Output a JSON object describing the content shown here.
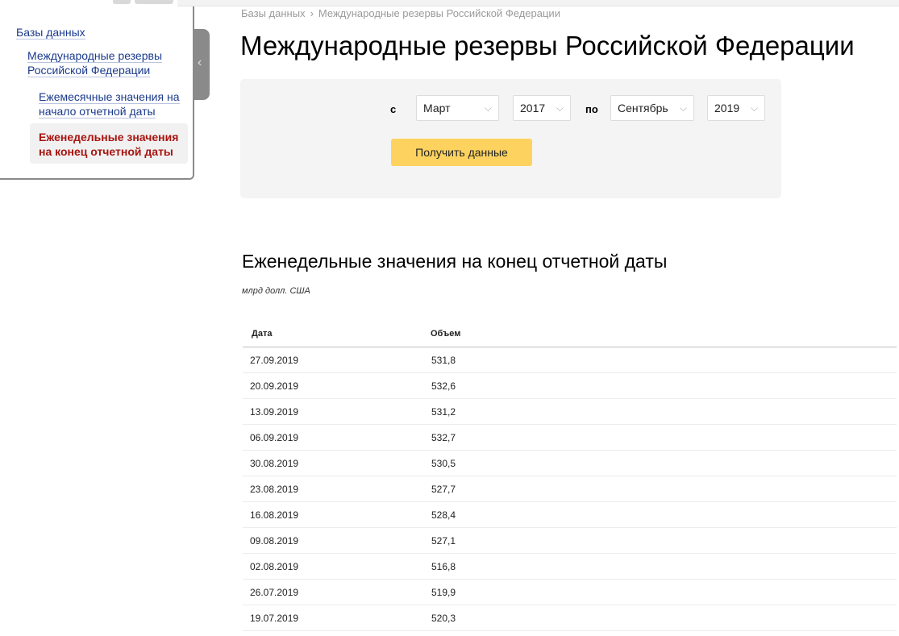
{
  "breadcrumb": [
    "Базы данных",
    "Международные резервы Российской Федерации"
  ],
  "sidebar": {
    "root": "Базы данных",
    "level1": "Международные резервы Российской Федерации",
    "level2": "Ежемесячные значения на начало отчетной даты",
    "active": "Еженедельные значения на конец отчетной даты"
  },
  "page_title": "Международные резервы Российской Федерации",
  "filter": {
    "from_label": "с",
    "from_month": "Март",
    "from_year": "2017",
    "to_label": "по",
    "to_month": "Сентябрь",
    "to_year": "2019",
    "submit_label": "Получить данные"
  },
  "section": {
    "title": "Еженедельные значения на конец отчетной даты",
    "unit": "млрд долл. США"
  },
  "table": {
    "headers": [
      "Дата",
      "Объем"
    ],
    "rows": [
      [
        "27.09.2019",
        "531,8"
      ],
      [
        "20.09.2019",
        "532,6"
      ],
      [
        "13.09.2019",
        "531,2"
      ],
      [
        "06.09.2019",
        "532,7"
      ],
      [
        "30.08.2019",
        "530,5"
      ],
      [
        "23.08.2019",
        "527,7"
      ],
      [
        "16.08.2019",
        "528,4"
      ],
      [
        "09.08.2019",
        "527,1"
      ],
      [
        "02.08.2019",
        "516,8"
      ],
      [
        "26.07.2019",
        "519,9"
      ],
      [
        "19.07.2019",
        "520,3"
      ]
    ]
  },
  "colors": {
    "link": "#1b3a8c",
    "active_item": "#a8140f",
    "button": "#fdd25e",
    "panel": "#f4f4f4"
  },
  "icons": {
    "collapse": "chevron-left-icon",
    "breadcrumb_sep": "chevron-right-icon",
    "select_arrow": "chevron-down-icon"
  }
}
